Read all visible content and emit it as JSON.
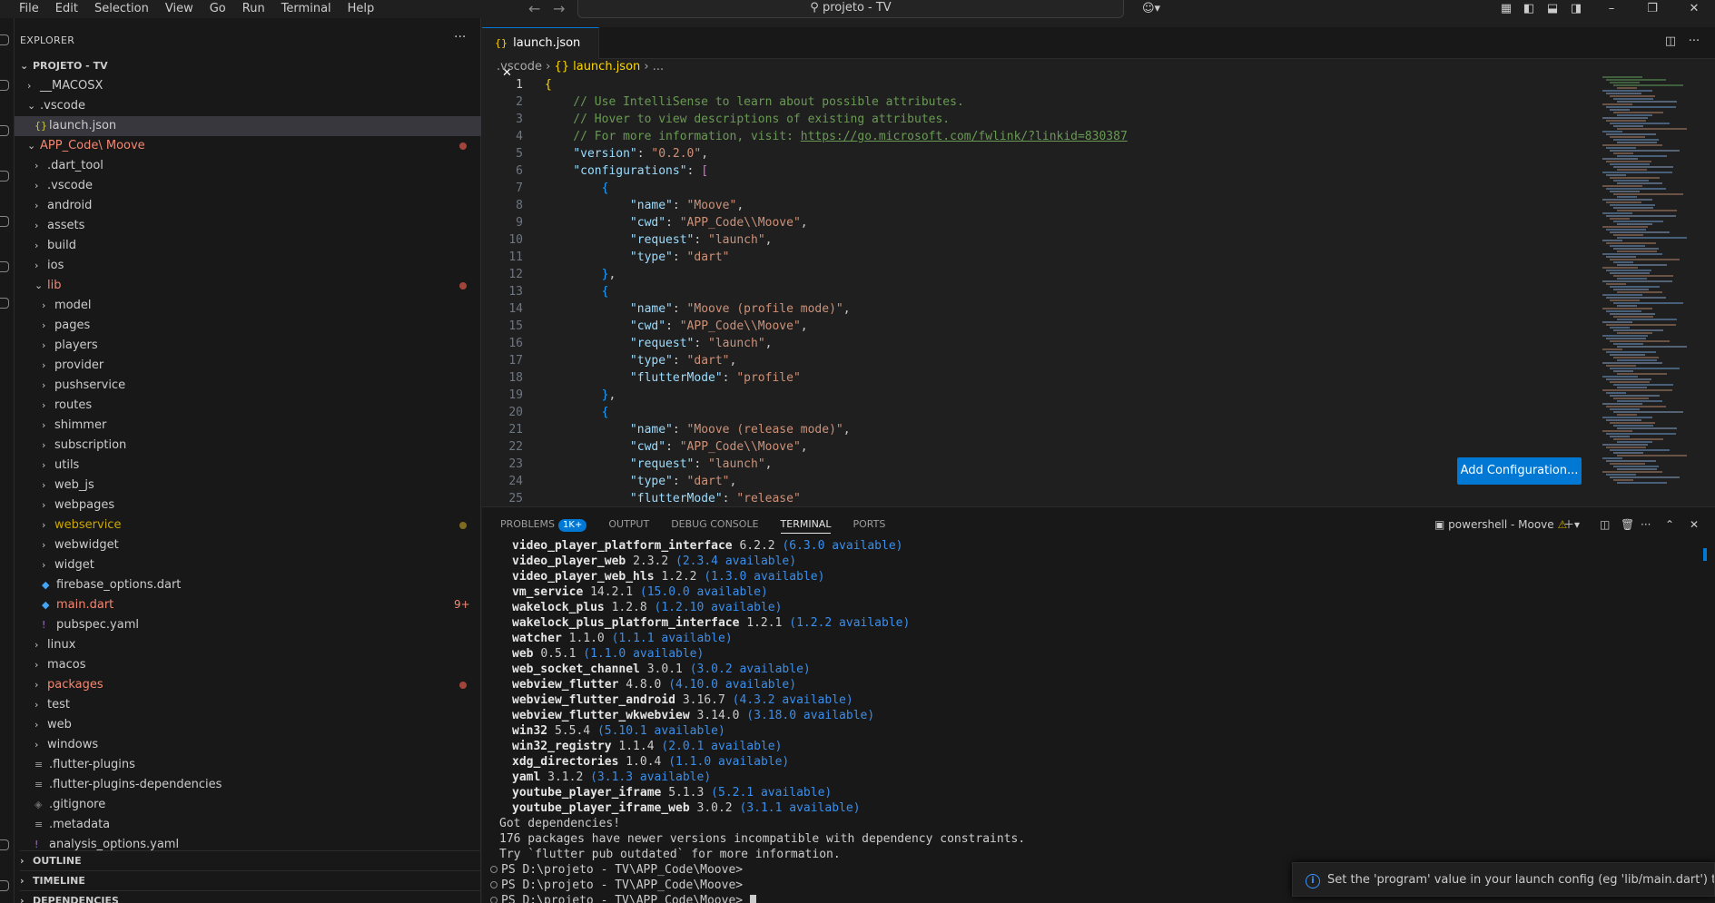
{
  "menu": [
    "File",
    "Edit",
    "Selection",
    "View",
    "Go",
    "Run",
    "Terminal",
    "Help"
  ],
  "title_search": "projeto - TV",
  "explorer": {
    "title": "EXPLORER",
    "root": "PROJETO - TV",
    "items": [
      {
        "label": "__MACOSX",
        "type": "folder",
        "open": false,
        "depth": 1
      },
      {
        "label": ".vscode",
        "type": "folder",
        "open": true,
        "depth": 1
      },
      {
        "label": "launch.json",
        "type": "json",
        "depth": 2,
        "selected": true
      },
      {
        "label": "APP_Code\\ Moove",
        "type": "folder",
        "open": true,
        "depth": 1,
        "status": "error"
      },
      {
        "label": ".dart_tool",
        "type": "folder",
        "open": false,
        "depth": 2
      },
      {
        "label": ".vscode",
        "type": "folder",
        "open": false,
        "depth": 2
      },
      {
        "label": "android",
        "type": "folder",
        "open": false,
        "depth": 2
      },
      {
        "label": "assets",
        "type": "folder",
        "open": false,
        "depth": 2
      },
      {
        "label": "build",
        "type": "folder",
        "open": false,
        "depth": 2
      },
      {
        "label": "ios",
        "type": "folder",
        "open": false,
        "depth": 2
      },
      {
        "label": "lib",
        "type": "folder",
        "open": true,
        "depth": 2,
        "status": "error"
      },
      {
        "label": "model",
        "type": "folder",
        "open": false,
        "depth": 3
      },
      {
        "label": "pages",
        "type": "folder",
        "open": false,
        "depth": 3
      },
      {
        "label": "players",
        "type": "folder",
        "open": false,
        "depth": 3
      },
      {
        "label": "provider",
        "type": "folder",
        "open": false,
        "depth": 3
      },
      {
        "label": "pushservice",
        "type": "folder",
        "open": false,
        "depth": 3
      },
      {
        "label": "routes",
        "type": "folder",
        "open": false,
        "depth": 3
      },
      {
        "label": "shimmer",
        "type": "folder",
        "open": false,
        "depth": 3
      },
      {
        "label": "subscription",
        "type": "folder",
        "open": false,
        "depth": 3
      },
      {
        "label": "utils",
        "type": "folder",
        "open": false,
        "depth": 3
      },
      {
        "label": "web_js",
        "type": "folder",
        "open": false,
        "depth": 3
      },
      {
        "label": "webpages",
        "type": "folder",
        "open": false,
        "depth": 3
      },
      {
        "label": "webservice",
        "type": "folder",
        "open": false,
        "depth": 3,
        "status": "warn"
      },
      {
        "label": "webwidget",
        "type": "folder",
        "open": false,
        "depth": 3
      },
      {
        "label": "widget",
        "type": "folder",
        "open": false,
        "depth": 3
      },
      {
        "label": "firebase_options.dart",
        "type": "dart",
        "depth": 3
      },
      {
        "label": "main.dart",
        "type": "dart",
        "depth": 3,
        "status": "error",
        "count": "9+"
      },
      {
        "label": "pubspec.yaml",
        "type": "yaml",
        "depth": 3
      },
      {
        "label": "linux",
        "type": "folder",
        "open": false,
        "depth": 2
      },
      {
        "label": "macos",
        "type": "folder",
        "open": false,
        "depth": 2
      },
      {
        "label": "packages",
        "type": "folder",
        "open": false,
        "depth": 2,
        "status": "error"
      },
      {
        "label": "test",
        "type": "folder",
        "open": false,
        "depth": 2
      },
      {
        "label": "web",
        "type": "folder",
        "open": false,
        "depth": 2
      },
      {
        "label": "windows",
        "type": "folder",
        "open": false,
        "depth": 2
      },
      {
        "label": ".flutter-plugins",
        "type": "plain",
        "depth": 2
      },
      {
        "label": ".flutter-plugins-dependencies",
        "type": "plain",
        "depth": 2
      },
      {
        "label": ".gitignore",
        "type": "git",
        "depth": 2
      },
      {
        "label": ".metadata",
        "type": "plain",
        "depth": 2
      },
      {
        "label": "analysis_options.yaml",
        "type": "yaml",
        "depth": 2
      }
    ],
    "sections": [
      "OUTLINE",
      "TIMELINE",
      "DEPENDENCIES"
    ]
  },
  "editor": {
    "tab": "launch.json",
    "breadcrumb": [
      ".vscode",
      "{} launch.json",
      "..."
    ],
    "lines": [
      "{",
      "    // Use IntelliSense to learn about possible attributes.",
      "    // Hover to view descriptions of existing attributes.",
      "    // For more information, visit: https://go.microsoft.com/fwlink/?linkid=830387",
      "    \"version\": \"0.2.0\",",
      "    \"configurations\": [",
      "        {",
      "            \"name\": \"Moove\",",
      "            \"cwd\": \"APP_Code\\\\Moove\",",
      "            \"request\": \"launch\",",
      "            \"type\": \"dart\"",
      "        },",
      "        {",
      "            \"name\": \"Moove (profile mode)\",",
      "            \"cwd\": \"APP_Code\\\\Moove\",",
      "            \"request\": \"launch\",",
      "            \"type\": \"dart\",",
      "            \"flutterMode\": \"profile\"",
      "        },",
      "        {",
      "            \"name\": \"Moove (release mode)\",",
      "            \"cwd\": \"APP_Code\\\\Moove\",",
      "            \"request\": \"launch\",",
      "            \"type\": \"dart\",",
      "            \"flutterMode\": \"release\""
    ],
    "add_config": "Add Configuration..."
  },
  "panel": {
    "tabs": [
      "PROBLEMS",
      "OUTPUT",
      "DEBUG CONSOLE",
      "TERMINAL",
      "PORTS"
    ],
    "problems_badge": "1K+",
    "active_tab": "TERMINAL",
    "terminal_name": "powershell - Moove",
    "packages": [
      [
        "video_player_platform_interface",
        "6.2.2",
        "(6.3.0 available)"
      ],
      [
        "video_player_web",
        "2.3.2",
        "(2.3.4 available)"
      ],
      [
        "video_player_web_hls",
        "1.2.2",
        "(1.3.0 available)"
      ],
      [
        "vm_service",
        "14.2.1",
        "(15.0.0 available)"
      ],
      [
        "wakelock_plus",
        "1.2.8",
        "(1.2.10 available)"
      ],
      [
        "wakelock_plus_platform_interface",
        "1.2.1",
        "(1.2.2 available)"
      ],
      [
        "watcher",
        "1.1.0",
        "(1.1.1 available)"
      ],
      [
        "web",
        "0.5.1",
        "(1.1.0 available)"
      ],
      [
        "web_socket_channel",
        "3.0.1",
        "(3.0.2 available)"
      ],
      [
        "webview_flutter",
        "4.8.0",
        "(4.10.0 available)"
      ],
      [
        "webview_flutter_android",
        "3.16.7",
        "(4.3.2 available)"
      ],
      [
        "webview_flutter_wkwebview",
        "3.14.0",
        "(3.18.0 available)"
      ],
      [
        "win32",
        "5.5.4",
        "(5.10.1 available)"
      ],
      [
        "win32_registry",
        "1.1.4",
        "(2.0.1 available)"
      ],
      [
        "xdg_directories",
        "1.0.4",
        "(1.1.0 available)"
      ],
      [
        "yaml",
        "3.1.2",
        "(3.1.3 available)"
      ],
      [
        "youtube_player_iframe",
        "5.1.3",
        "(5.2.1 available)"
      ],
      [
        "youtube_player_iframe_web",
        "3.0.2",
        "(3.1.1 available)"
      ]
    ],
    "messages": [
      "Got dependencies!",
      "176 packages have newer versions incompatible with dependency constraints.",
      "Try `flutter pub outdated` for more information."
    ],
    "prompts": [
      "PS D:\\projeto - TV\\APP_Code\\Moove>",
      "PS D:\\projeto - TV\\APP_Code\\Moove>",
      "PS D:\\projeto - TV\\APP_Code\\Moove>"
    ]
  },
  "notification": "Set the 'program' value in your launch config (eg 'lib/main.dart') then l...",
  "colors": {
    "accent": "#0078d4",
    "error": "#f48771",
    "warning": "#cca700"
  }
}
